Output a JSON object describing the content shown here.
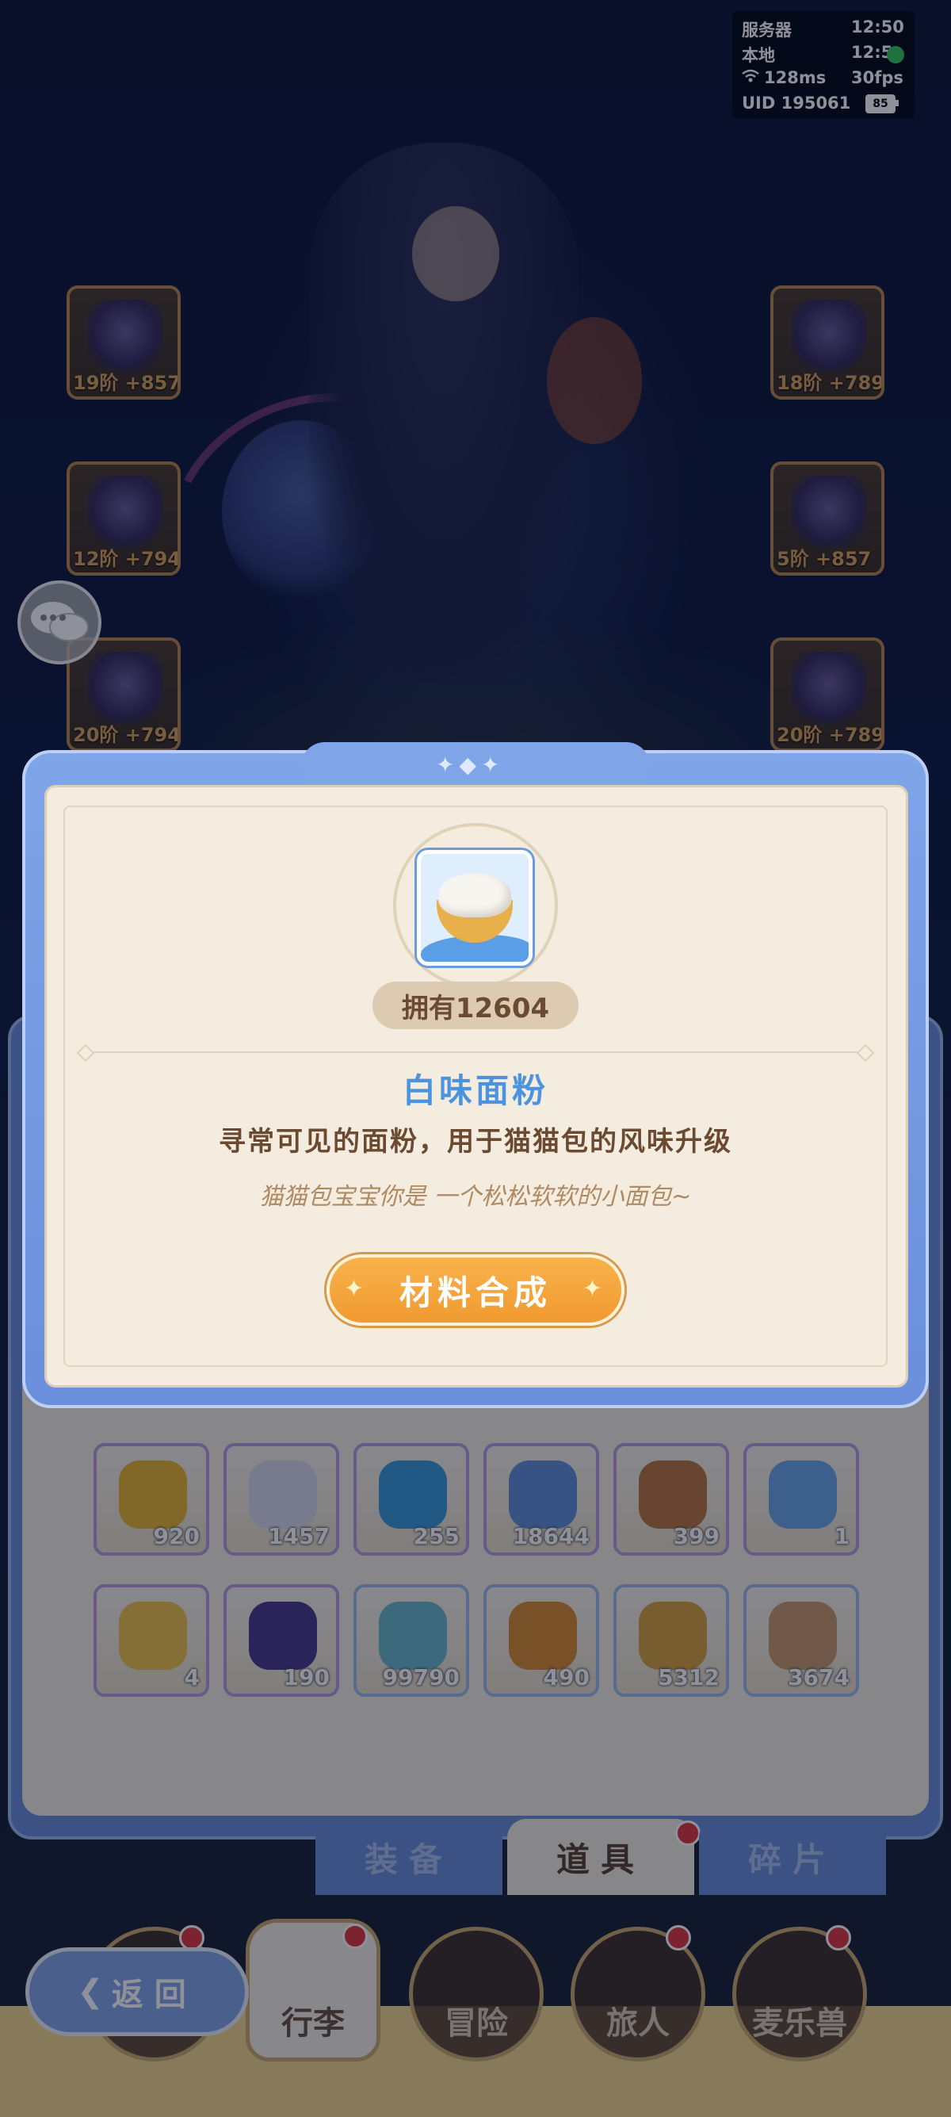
{
  "hud": {
    "server_label": "服务器",
    "server_time": "12:50",
    "local_label": "本地",
    "local_time": "12:5",
    "ping": "128ms",
    "fps": "30fps",
    "uid": "UID  195061",
    "battery": "85"
  },
  "equipment": [
    {
      "level": "19阶 +857",
      "icon": "sword-icon"
    },
    {
      "level": "12阶 +794",
      "icon": "chest-armor-icon"
    },
    {
      "level": "20阶 +794",
      "icon": "pants-armor-icon"
    },
    {
      "level": "18阶 +789",
      "icon": "helmet-icon"
    },
    {
      "level": "5阶 +857",
      "icon": "gauntlet-icon"
    },
    {
      "level": "20阶 +789",
      "icon": "boots-icon"
    }
  ],
  "modal": {
    "item_icon": "flour-bowl-icon",
    "owned": "拥有12604",
    "name": "白味面粉",
    "description": "寻常可见的面粉，用于猫猫包的风味升级",
    "flavor": "猫猫包宝宝你是 一个松松软软的小面包~",
    "craft_label": "材料合成",
    "colors": {
      "name": "#4b93df",
      "button": "#f5a63c",
      "frame": "#7fa4e8"
    }
  },
  "inventory": {
    "rows": [
      [
        {
          "qty": "920",
          "icon": "yellow-star-flower-icon",
          "color": "#e8b530",
          "rarity": "purple"
        },
        {
          "qty": "1457",
          "icon": "paint-tube-icon",
          "color": "#d8d8e8",
          "rarity": "purple"
        },
        {
          "qty": "255",
          "icon": "blue-slime-icon",
          "color": "#3b9ad8",
          "rarity": "purple"
        },
        {
          "qty": "18644",
          "icon": "card-pack-icon",
          "color": "#5f8fd8",
          "rarity": "purple"
        },
        {
          "qty": "399",
          "icon": "book-icon",
          "color": "#b8763e",
          "rarity": "purple"
        },
        {
          "qty": "1",
          "icon": "blue-flower-icon",
          "color": "#6aa4e6",
          "rarity": "purple"
        }
      ],
      [
        {
          "qty": "4",
          "icon": "yellow-flower-icon",
          "color": "#f0c24a",
          "rarity": "purple"
        },
        {
          "qty": "190",
          "icon": "galaxy-egg-icon",
          "color": "#4a3a8a",
          "rarity": "purple"
        },
        {
          "qty": "99790",
          "icon": "crystal-icon",
          "color": "#6ab8c8",
          "rarity": "blue"
        },
        {
          "qty": "490",
          "icon": "amber-shard-icon",
          "color": "#d98a30",
          "rarity": "blue"
        },
        {
          "qty": "5312",
          "icon": "cat-mirror-icon",
          "color": "#d8a040",
          "rarity": "blue"
        },
        {
          "qty": "3674",
          "icon": "paw-pouch-icon",
          "color": "#c89a6a",
          "rarity": "blue"
        }
      ]
    ]
  },
  "tabs": [
    {
      "label": "装备",
      "active": false
    },
    {
      "label": "道具",
      "active": true
    },
    {
      "label": "碎片",
      "active": false
    }
  ],
  "nav": [
    {
      "label": "行李",
      "active": true
    },
    {
      "label": "冒险",
      "active": false
    },
    {
      "label": "旅人",
      "active": false
    },
    {
      "label": "麦乐兽",
      "active": false
    }
  ],
  "back_label": "返回"
}
